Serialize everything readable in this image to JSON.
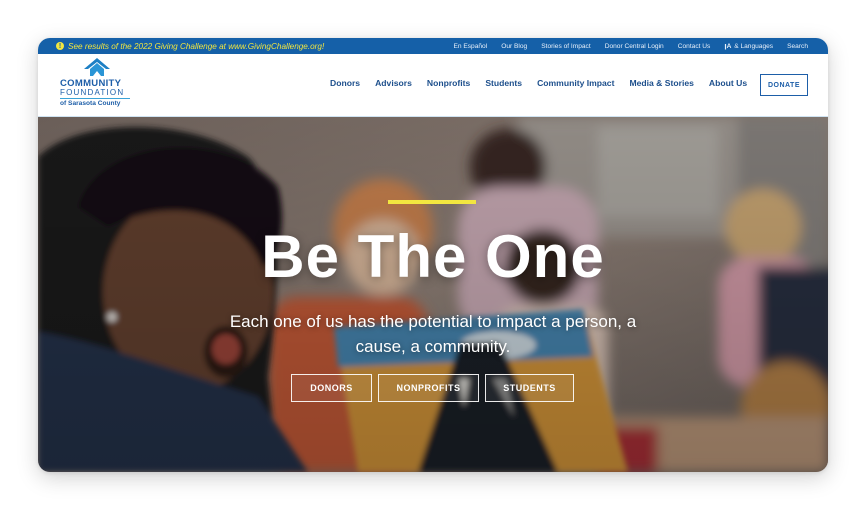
{
  "topbar": {
    "alert_text": "See results of the 2022 Giving Challenge at www.GivingChallenge.org!",
    "alert_icon": "exclamation-circle-icon",
    "links": [
      "En Español",
      "Our Blog",
      "Stories of Impact",
      "Donor Central Login",
      "Contact Us",
      "& Languages",
      "Search"
    ],
    "lang_icon": "translate-icon",
    "color": "#1560a8",
    "alert_color": "#f2e640"
  },
  "header": {
    "logo": {
      "line1": "COMMUNITY",
      "line2": "FOUNDATION",
      "line3": "of Sarasota County"
    },
    "nav": [
      "Donors",
      "Advisors",
      "Nonprofits",
      "Students",
      "Community Impact",
      "Media & Stories",
      "About Us"
    ],
    "donate_label": "DONATE",
    "brand_color": "#1d5ea8"
  },
  "hero": {
    "title": "Be The One",
    "subtitle": "Each one of us has the potential to impact a person, a cause, a community.",
    "buttons": [
      "DONORS",
      "NONPROFITS",
      "STUDENTS"
    ],
    "accent_color": "#f2e640"
  }
}
